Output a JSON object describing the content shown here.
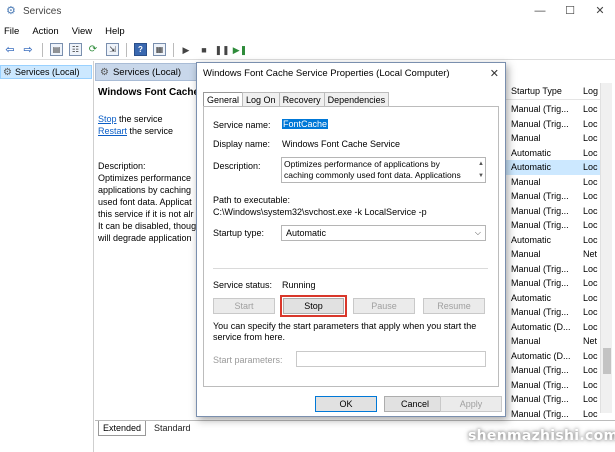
{
  "window": {
    "title": "Services",
    "icon": "gear-icon",
    "controls": {
      "minimize": "—",
      "maximize": "☐",
      "close": "✕"
    }
  },
  "menu": [
    "File",
    "Action",
    "View",
    "Help"
  ],
  "tree": {
    "item": "Services (Local)"
  },
  "panel": {
    "header": "Services (Local)",
    "service_title": "Windows Font Cache Se",
    "stop_link": "Stop",
    "stop_suffix": " the service",
    "restart_link": "Restart",
    "restart_suffix": " the service",
    "description_label": "Description:",
    "description_lines": [
      "Optimizes performance",
      "applications by caching",
      "used font data. Applicat",
      "this service if it is not alr",
      "It can be disabled, thoug",
      "will degrade application"
    ]
  },
  "columns": {
    "startup_type": "Startup Type",
    "log_on": "Log"
  },
  "rows": [
    {
      "type": "Manual (Trig...",
      "logon": "Loc",
      "selected": false
    },
    {
      "type": "Manual (Trig...",
      "logon": "Loc",
      "selected": false
    },
    {
      "type": "Manual",
      "logon": "Loc",
      "selected": false
    },
    {
      "type": "Automatic",
      "logon": "Loc",
      "selected": false
    },
    {
      "type": "Automatic",
      "logon": "Loc",
      "selected": true
    },
    {
      "type": "Manual",
      "logon": "Loc",
      "selected": false
    },
    {
      "type": "Manual (Trig...",
      "logon": "Loc",
      "selected": false
    },
    {
      "type": "Manual (Trig...",
      "logon": "Loc",
      "selected": false
    },
    {
      "type": "Manual (Trig...",
      "logon": "Loc",
      "selected": false
    },
    {
      "type": "Automatic",
      "logon": "Loc",
      "selected": false
    },
    {
      "type": "Manual",
      "logon": "Net",
      "selected": false
    },
    {
      "type": "Manual (Trig...",
      "logon": "Loc",
      "selected": false
    },
    {
      "type": "Manual (Trig...",
      "logon": "Loc",
      "selected": false
    },
    {
      "type": "Automatic",
      "logon": "Loc",
      "selected": false
    },
    {
      "type": "Manual (Trig...",
      "logon": "Loc",
      "selected": false
    },
    {
      "type": "Automatic (D...",
      "logon": "Loc",
      "selected": false
    },
    {
      "type": "Manual",
      "logon": "Net",
      "selected": false
    },
    {
      "type": "Automatic (D...",
      "logon": "Loc",
      "selected": false
    },
    {
      "type": "Manual (Trig...",
      "logon": "Loc",
      "selected": false
    },
    {
      "type": "Manual (Trig...",
      "logon": "Loc",
      "selected": false
    },
    {
      "type": "Manual (Trig...",
      "logon": "Loc",
      "selected": false
    },
    {
      "type": "Manual (Trig...",
      "logon": "Loc",
      "selected": false
    }
  ],
  "bottom_tabs": {
    "extended": "Extended",
    "standard": "Standard"
  },
  "watermark": "shenmazhishi.com",
  "dialog": {
    "title": "Windows Font Cache Service Properties (Local Computer)",
    "close": "✕",
    "tabs": [
      "General",
      "Log On",
      "Recovery",
      "Dependencies"
    ],
    "service_name_label": "Service name:",
    "service_name": "FontCache",
    "display_name_label": "Display name:",
    "display_name": "Windows Font Cache Service",
    "description_label": "Description:",
    "description": "Optimizes performance of applications by caching commonly used font data. Applications will start this",
    "path_label": "Path to executable:",
    "path": "C:\\Windows\\system32\\svchost.exe -k LocalService -p",
    "startup_type_label": "Startup type:",
    "startup_type": "Automatic",
    "status_label": "Service status:",
    "status": "Running",
    "buttons": {
      "start": "Start",
      "stop": "Stop",
      "pause": "Pause",
      "resume": "Resume"
    },
    "hint": "You can specify the start parameters that apply when you start the service from here.",
    "params_label": "Start parameters:",
    "params_value": "",
    "ok": "OK",
    "cancel": "Cancel",
    "apply": "Apply"
  }
}
